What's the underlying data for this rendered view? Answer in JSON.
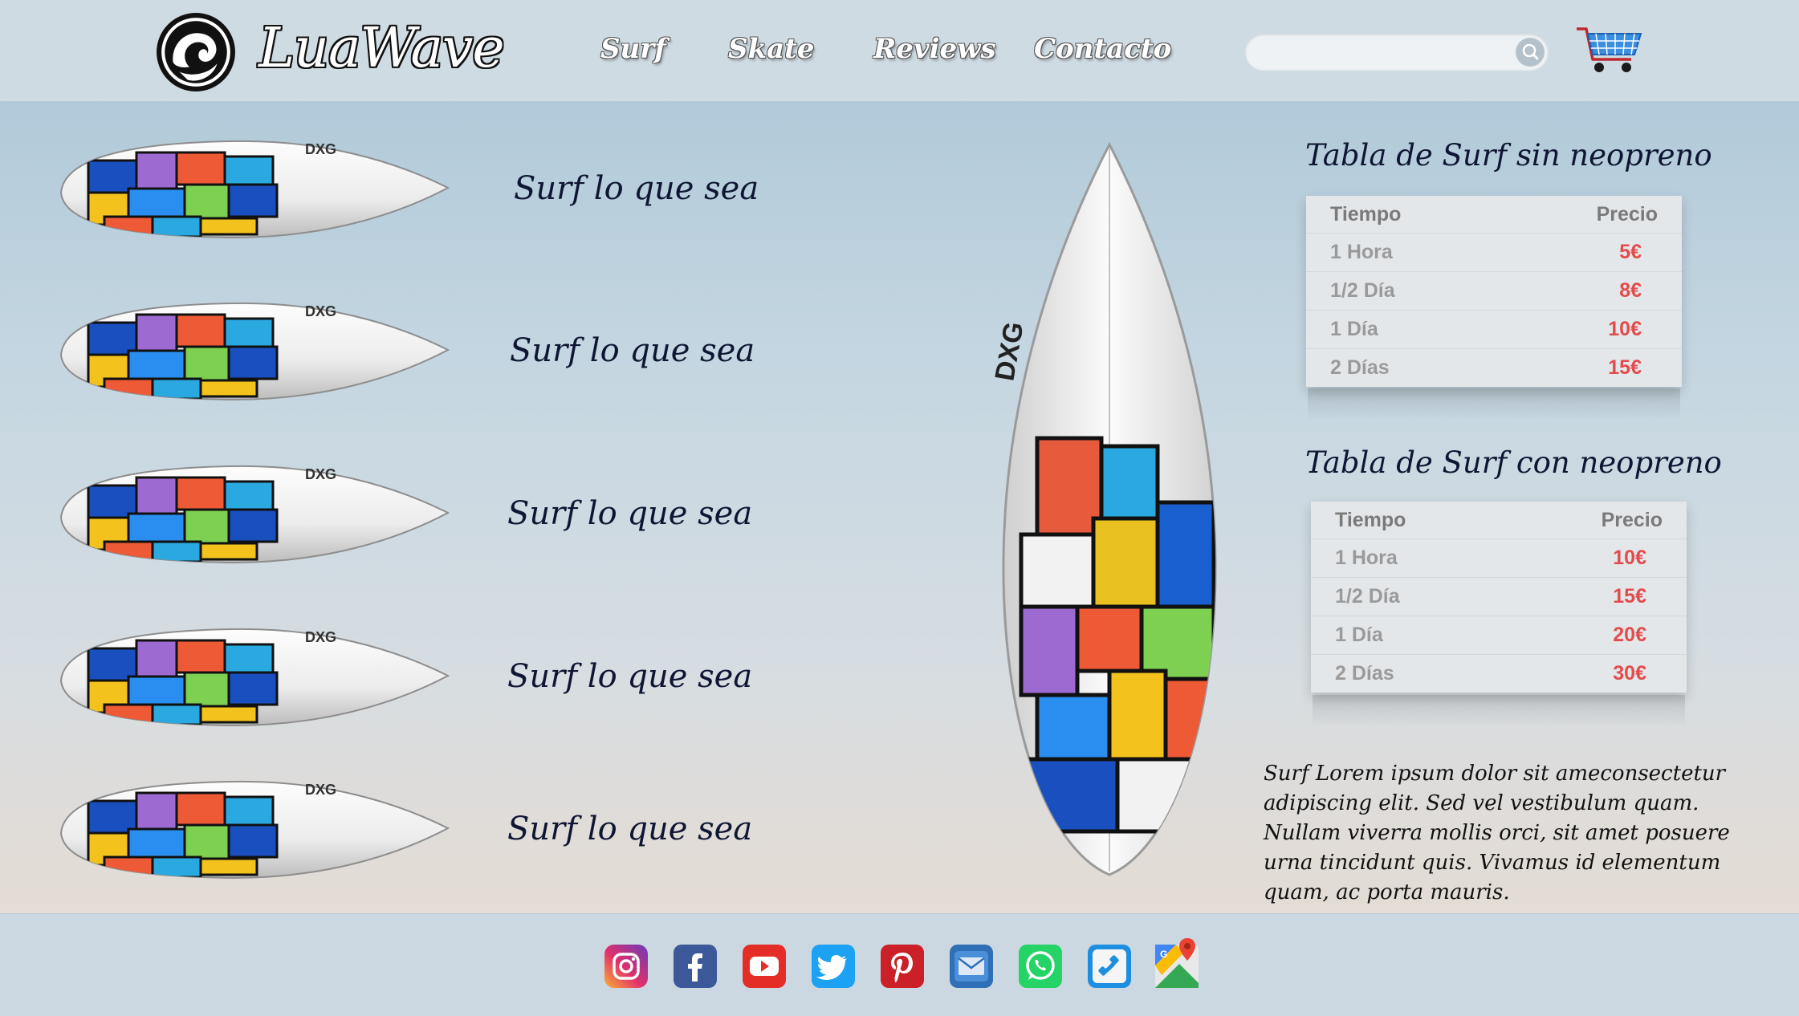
{
  "header": {
    "brand": "LuaWave",
    "nav": [
      "Surf",
      "Skate",
      "Reviews",
      "Contacto"
    ],
    "search": {
      "placeholder": "",
      "value": ""
    },
    "icons": {
      "logo": "wave-logo-icon",
      "search": "search-icon",
      "cart": "shopping-cart-icon"
    }
  },
  "boards": [
    {
      "label": "Surf lo que sea"
    },
    {
      "label": "Surf lo que sea"
    },
    {
      "label": "Surf lo que sea"
    },
    {
      "label": "Surf lo que sea"
    },
    {
      "label": "Surf lo que sea"
    }
  ],
  "tables": [
    {
      "title": "Tabla de Surf sin neopreno",
      "headers": [
        "Tiempo",
        "Precio"
      ],
      "rows": [
        {
          "time": "1 Hora",
          "price": "5€"
        },
        {
          "time": "1/2 Día",
          "price": "8€"
        },
        {
          "time": "1 Día",
          "price": "10€"
        },
        {
          "time": "2 Días",
          "price": "15€"
        }
      ]
    },
    {
      "title": "Tabla de Surf con neopreno",
      "headers": [
        "Tiempo",
        "Precio"
      ],
      "rows": [
        {
          "time": "1 Hora",
          "price": "10€"
        },
        {
          "time": "1/2 Día",
          "price": "15€"
        },
        {
          "time": "1 Día",
          "price": "20€"
        },
        {
          "time": "2 Días",
          "price": "30€"
        }
      ]
    }
  ],
  "description": "Surf Lorem ipsum dolor sit ameconsectetur adipiscing elit. Sed vel vestibulum quam. Nullam viverra mollis orci, sit amet posuere urna tincidunt quis. Vivamus id elementum quam, ac porta mauris.",
  "footer": {
    "social": [
      "instagram-icon",
      "facebook-icon",
      "youtube-icon",
      "twitter-icon",
      "pinterest-icon",
      "mail-icon",
      "whatsapp-icon",
      "phone-icon",
      "google-maps-icon"
    ]
  },
  "colors": {
    "price": "#e24c4c",
    "heading": "#0f1634",
    "header_bg": "#cfdbe3"
  }
}
